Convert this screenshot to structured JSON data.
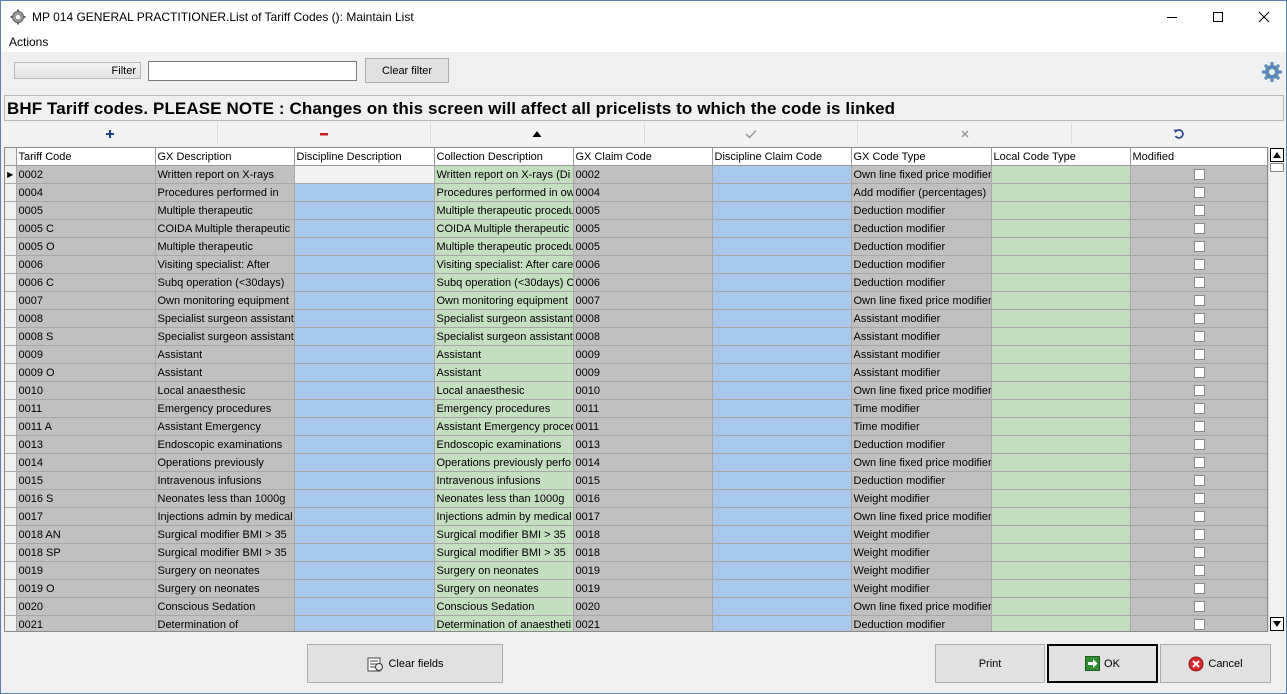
{
  "window": {
    "title": "MP 014 GENERAL PRACTITIONER.List of Tariff Codes (): Maintain List"
  },
  "menu": {
    "actions": "Actions"
  },
  "filter": {
    "label": "Filter",
    "value": "",
    "clear_label": "Clear filter"
  },
  "banner": "BHF Tariff codes. PLEASE NOTE : Changes on this screen will affect all pricelists to which the code is linked",
  "nav_icons": [
    "plus-icon",
    "minus-icon",
    "triangle-up-icon",
    "checkmark-icon",
    "x-icon",
    "refresh-icon"
  ],
  "colors": {
    "blue_cell": "#a8c8ec",
    "green_cell": "#c4dfc0",
    "gray_cell": "#c0c0c0"
  },
  "grid": {
    "columns": [
      "Tariff Code",
      "GX Description",
      "Discipline Description",
      "Collection Description",
      "GX Claim Code",
      "Discipline Claim Code",
      "GX Code Type",
      "Local Code Type",
      "Modified"
    ],
    "rows": [
      [
        "0002",
        "Written report on X-rays",
        "",
        "Written report on X-rays (Di",
        "0002",
        "",
        "Own line fixed price modifier",
        ""
      ],
      [
        "0004",
        "Procedures performed in",
        "",
        "Procedures performed in ow",
        "0004",
        "",
        "Add modifier (percentages)",
        ""
      ],
      [
        "0005",
        "Multiple therapeutic",
        "",
        "Multiple therapeutic procedu",
        "0005",
        "",
        "Deduction modifier",
        ""
      ],
      [
        "0005 C",
        "COIDA Multiple therapeutic",
        "",
        "COIDA Multiple therapeutic p",
        "0005",
        "",
        "Deduction modifier",
        ""
      ],
      [
        "0005 O",
        "Multiple therapeutic",
        "",
        "Multiple therapeutic procedu",
        "0005",
        "",
        "Deduction modifier",
        ""
      ],
      [
        "0006",
        "Visiting specialist: After",
        "",
        "Visiting specialist: After care",
        "0006",
        "",
        "Deduction modifier",
        ""
      ],
      [
        "0006 C",
        "Subq operation (<30days)",
        "",
        "Subq operation (<30days) C",
        "0006",
        "",
        "Deduction modifier",
        ""
      ],
      [
        "0007",
        "Own monitoring equipment",
        "",
        "Own monitoring equipment",
        "0007",
        "",
        "Own line fixed price modifier",
        ""
      ],
      [
        "0008",
        "Specialist surgeon assistant",
        "",
        "Specialist surgeon assistant",
        "0008",
        "",
        "Assistant modifier",
        ""
      ],
      [
        "0008 S",
        "Specialist surgeon assistant",
        "",
        "Specialist surgeon assistant",
        "0008",
        "",
        "Assistant modifier",
        ""
      ],
      [
        "0009",
        "Assistant",
        "",
        "Assistant",
        "0009",
        "",
        "Assistant modifier",
        ""
      ],
      [
        "0009 O",
        "Assistant",
        "",
        "Assistant",
        "0009",
        "",
        "Assistant modifier",
        ""
      ],
      [
        "0010",
        "Local anaesthesic",
        "",
        "Local anaesthesic",
        "0010",
        "",
        "Own line fixed price modifier",
        ""
      ],
      [
        "0011",
        "Emergency procedures",
        "",
        "Emergency procedures",
        "0011",
        "",
        "Time modifier",
        ""
      ],
      [
        "0011 A",
        "Assistant Emergency",
        "",
        "Assistant Emergency proced",
        "0011",
        "",
        "Time modifier",
        ""
      ],
      [
        "0013",
        "Endoscopic examinations",
        "",
        "Endoscopic examinations",
        "0013",
        "",
        "Deduction modifier",
        ""
      ],
      [
        "0014",
        "Operations previously",
        "",
        "Operations previously perfo",
        "0014",
        "",
        "Own line fixed price modifier",
        ""
      ],
      [
        "0015",
        "Intravenous infusions",
        "",
        "Intravenous infusions",
        "0015",
        "",
        "Deduction modifier",
        ""
      ],
      [
        "0016 S",
        "Neonates less than 1000g",
        "",
        "Neonates less than 1000g",
        "0016",
        "",
        "Weight modifier",
        ""
      ],
      [
        "0017",
        "Injections admin by medical",
        "",
        "Injections admin by medical",
        "0017",
        "",
        "Own line fixed price modifier",
        ""
      ],
      [
        "0018 AN",
        "Surgical modifier BMI > 35",
        "",
        "Surgical modifier BMI > 35",
        "0018",
        "",
        "Weight modifier",
        ""
      ],
      [
        "0018 SP",
        "Surgical modifier BMI > 35",
        "",
        "Surgical modifier BMI > 35",
        "0018",
        "",
        "Weight modifier",
        ""
      ],
      [
        "0019",
        "Surgery on neonates",
        "",
        "Surgery on neonates",
        "0019",
        "",
        "Weight modifier",
        ""
      ],
      [
        "0019 O",
        "Surgery on neonates",
        "",
        "Surgery on neonates",
        "0019",
        "",
        "Weight modifier",
        ""
      ],
      [
        "0020",
        "Conscious Sedation",
        "",
        "Conscious Sedation",
        "0020",
        "",
        "Own line fixed price modifier",
        ""
      ],
      [
        "0021",
        "Determination of",
        "",
        "Determination of anaestheti",
        "0021",
        "",
        "Deduction modifier",
        ""
      ]
    ]
  },
  "buttons": {
    "clear_fields": "Clear fields",
    "print": "Print",
    "ok": "OK",
    "cancel": "Cancel"
  }
}
